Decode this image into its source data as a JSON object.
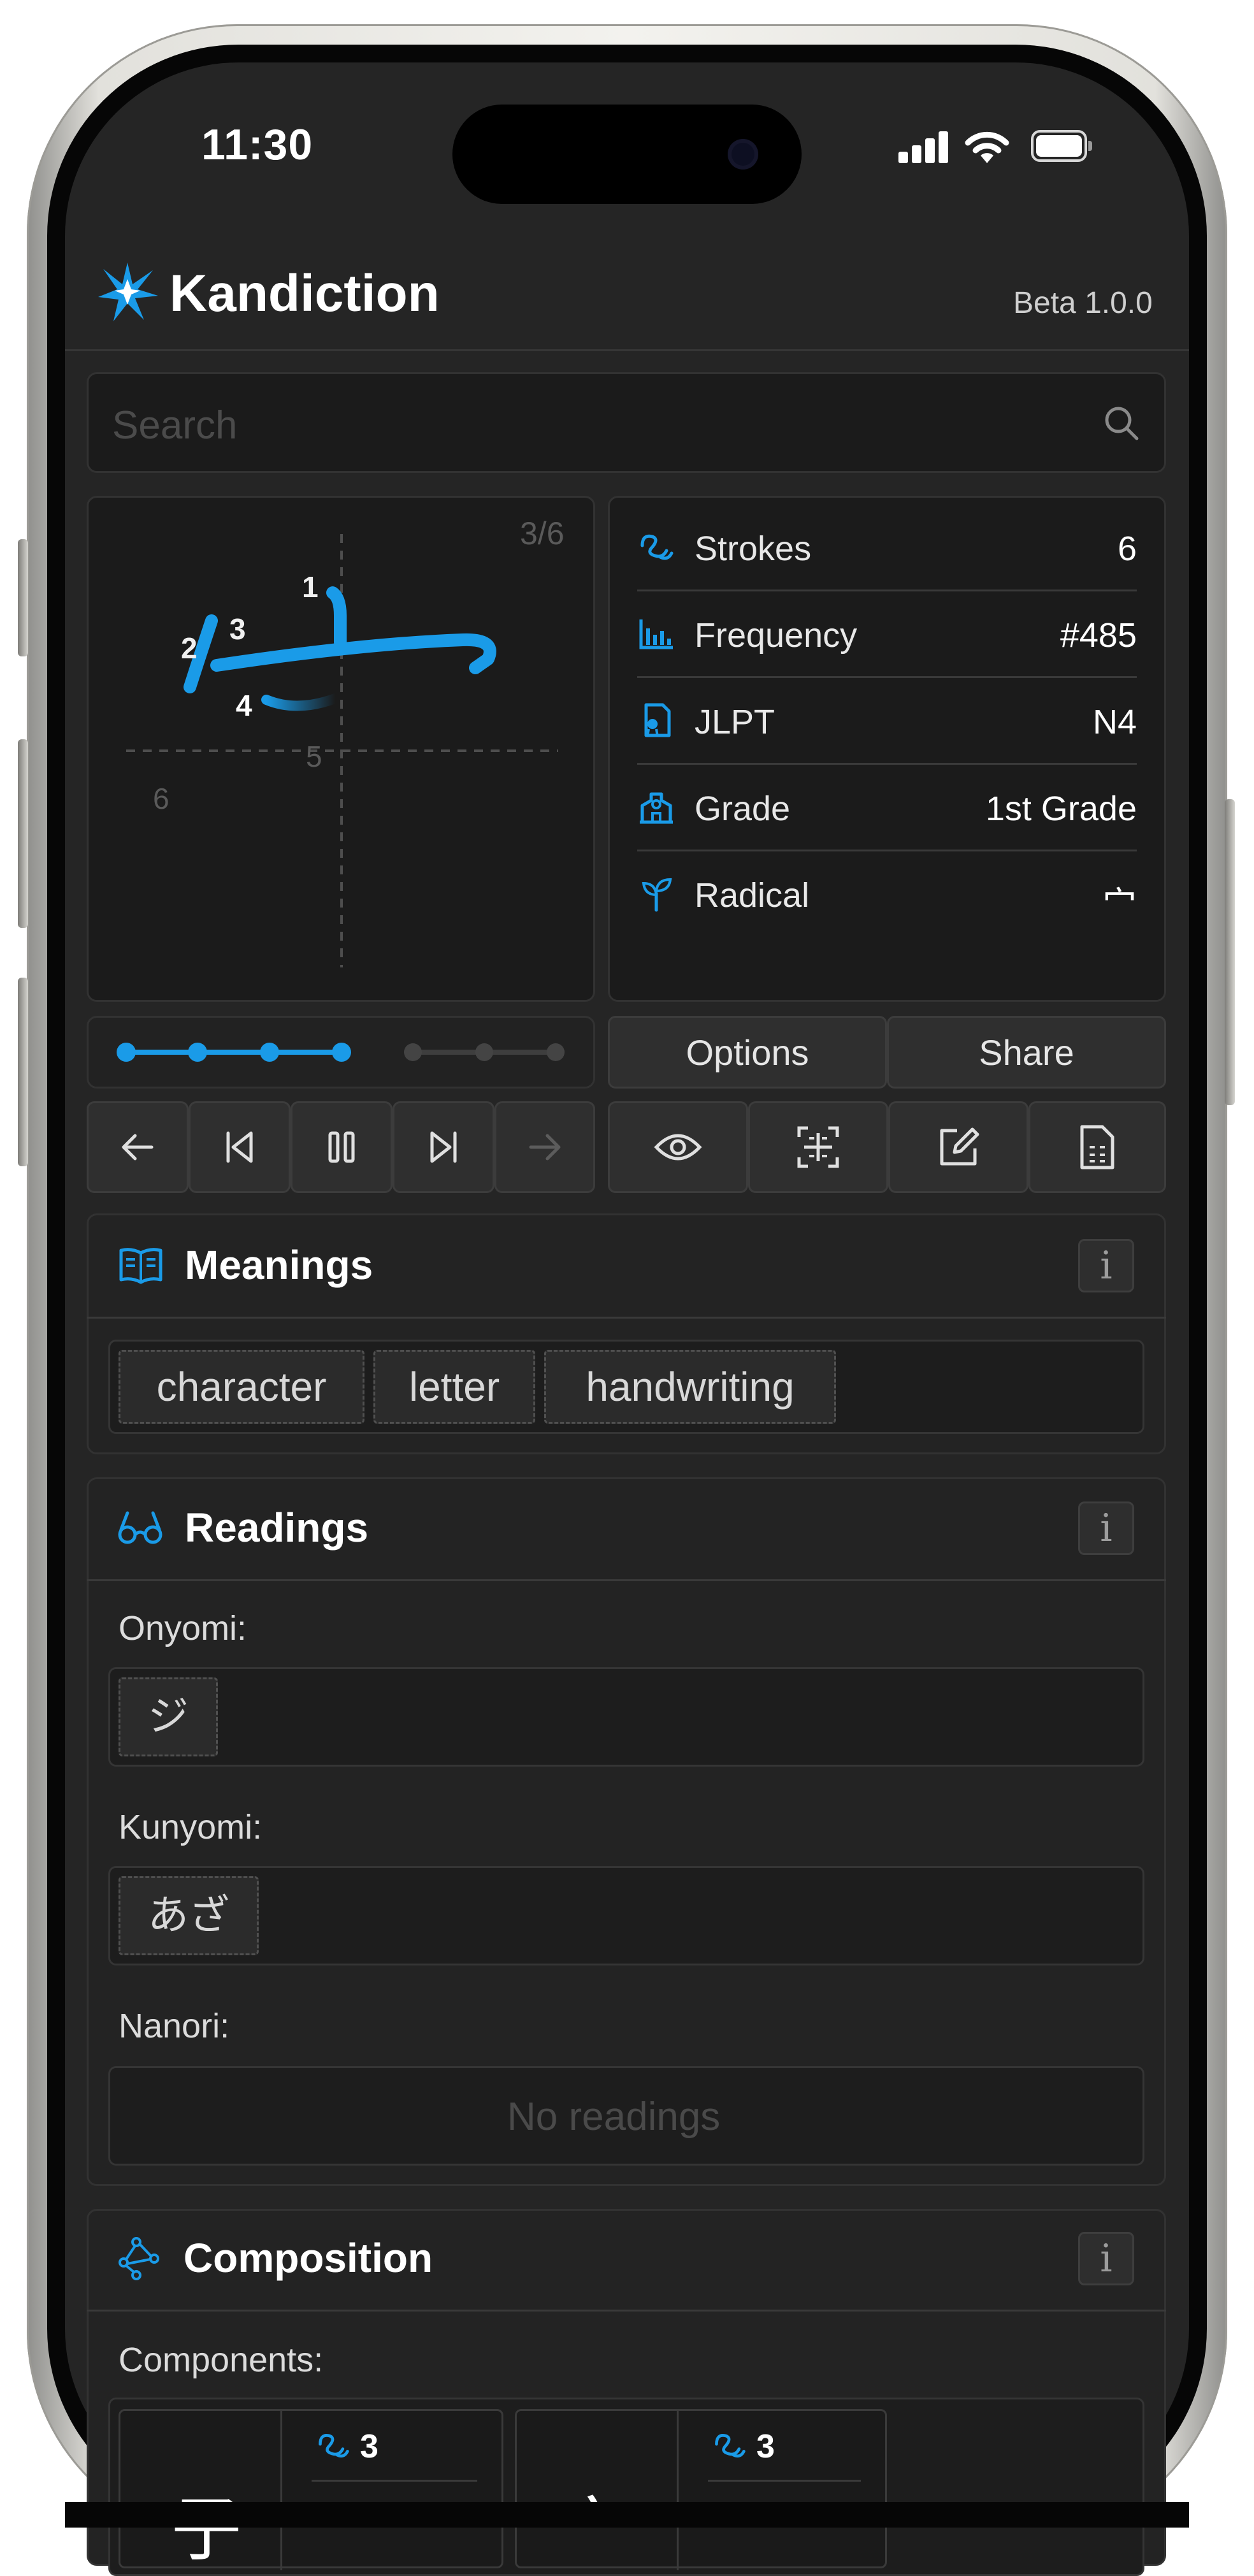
{
  "status_bar": {
    "time": "11:30"
  },
  "header": {
    "app_name": "Kandiction",
    "version": "Beta 1.0.0"
  },
  "search": {
    "placeholder": "Search"
  },
  "stroke_viewer": {
    "progress_label": "3/6",
    "stroke_numbers": [
      "1",
      "2",
      "3",
      "4",
      "5",
      "6"
    ],
    "current_stroke": 4,
    "total_strokes": 6
  },
  "stats": [
    {
      "icon": "strokes-icon",
      "label": "Strokes",
      "value": "6"
    },
    {
      "icon": "frequency-icon",
      "label": "Frequency",
      "value": "#485"
    },
    {
      "icon": "jlpt-icon",
      "label": "JLPT",
      "value": "N4"
    },
    {
      "icon": "school-icon",
      "label": "Grade",
      "value": "1st Grade"
    },
    {
      "icon": "sprout-icon",
      "label": "Radical",
      "value": "宀"
    }
  ],
  "actions": {
    "options": "Options",
    "share": "Share"
  },
  "playback_icons": [
    "arrow-left-icon",
    "step-back-icon",
    "pause-icon",
    "step-forward-icon",
    "arrow-right-icon"
  ],
  "tool_icons": [
    "eye-icon",
    "grid-focus-icon",
    "edit-icon",
    "document-icon"
  ],
  "meanings": {
    "title": "Meanings",
    "info": "i",
    "items": [
      "character",
      "letter",
      "handwriting"
    ]
  },
  "readings": {
    "title": "Readings",
    "info": "i",
    "onyomi_label": "Onyomi:",
    "onyomi": [
      "ジ"
    ],
    "kunyomi_label": "Kunyomi:",
    "kunyomi": [
      "あざ"
    ],
    "nanori_label": "Nanori:",
    "nanori_empty": "No readings"
  },
  "composition": {
    "title": "Composition",
    "info": "i",
    "components_label": "Components:",
    "components": [
      {
        "character": "子",
        "strokes": "3"
      },
      {
        "character": "宀",
        "strokes": "3"
      }
    ]
  },
  "colors": {
    "accent": "#1a9be8",
    "background": "#252525",
    "panel": "#1b1b1b"
  }
}
